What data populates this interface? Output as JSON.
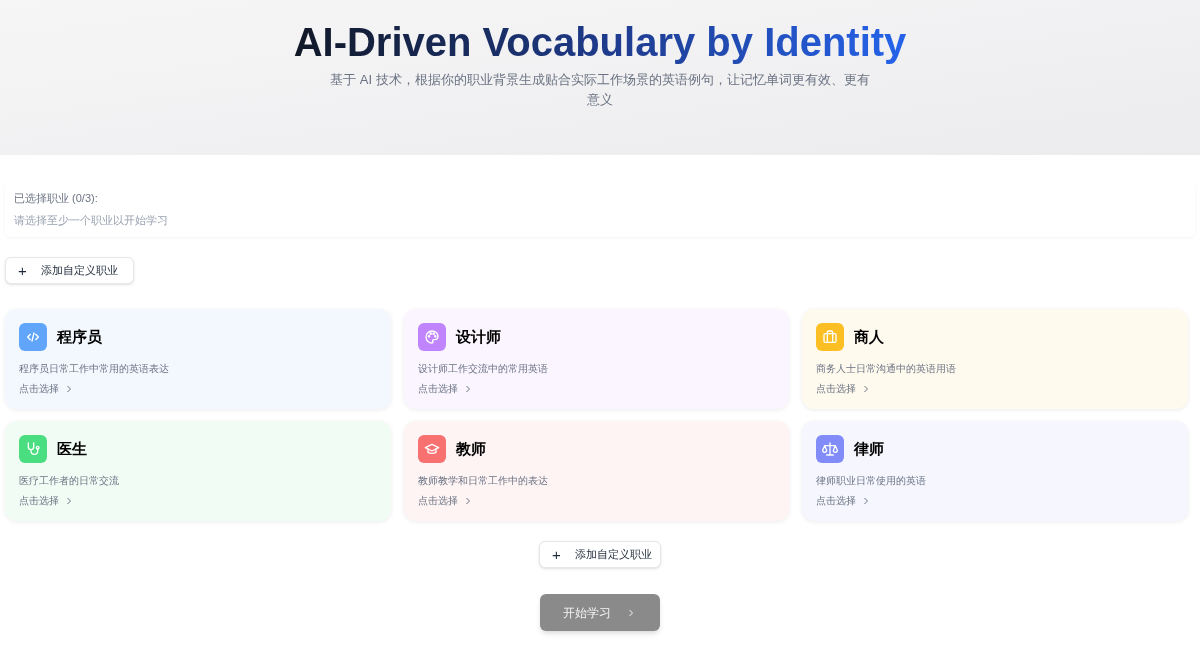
{
  "header": {
    "title": "AI-Driven Vocabulary by Identity",
    "subtitle": "基于 AI 技术，根据你的职业背景生成贴合实际工作场景的英语例句，让记忆单词更有效、更有意义"
  },
  "selection": {
    "label": "已选择职业 (0/3):",
    "hint": "请选择至少一个职业以开始学习"
  },
  "add_button_top": {
    "icon": "+",
    "label": "添加自定义职业"
  },
  "professions": [
    {
      "kind": "code",
      "color": "#60a5fa",
      "title": "程序员",
      "description": "程序员日常工作中常用的英语表达",
      "action": "点击选择",
      "selected": false
    },
    {
      "kind": "palette",
      "color": "#c084fc",
      "title": "设计师",
      "description": "设计师工作交流中的常用英语",
      "action": "点击选择",
      "selected": false
    },
    {
      "kind": "briefcase",
      "color": "#fbbf24",
      "title": "商人",
      "description": "商务人士日常沟通中的英语用语",
      "action": "点击选择",
      "selected": false
    },
    {
      "kind": "stethoscope",
      "color": "#4ade80",
      "title": "医生",
      "description": "医疗工作者的日常交流",
      "action": "点击选择",
      "selected": false
    },
    {
      "kind": "cap",
      "color": "#f87171",
      "title": "教师",
      "description": "教师教学和日常工作中的表达",
      "action": "点击选择",
      "selected": false
    },
    {
      "kind": "scale",
      "color": "#818cf8",
      "title": "律师",
      "description": "律师职业日常使用的英语",
      "action": "点击选择",
      "selected": false
    }
  ],
  "add_button_bottom": {
    "icon": "+",
    "label": "添加自定义职业"
  },
  "start_button": {
    "label": "开始学习",
    "disabled": true
  }
}
